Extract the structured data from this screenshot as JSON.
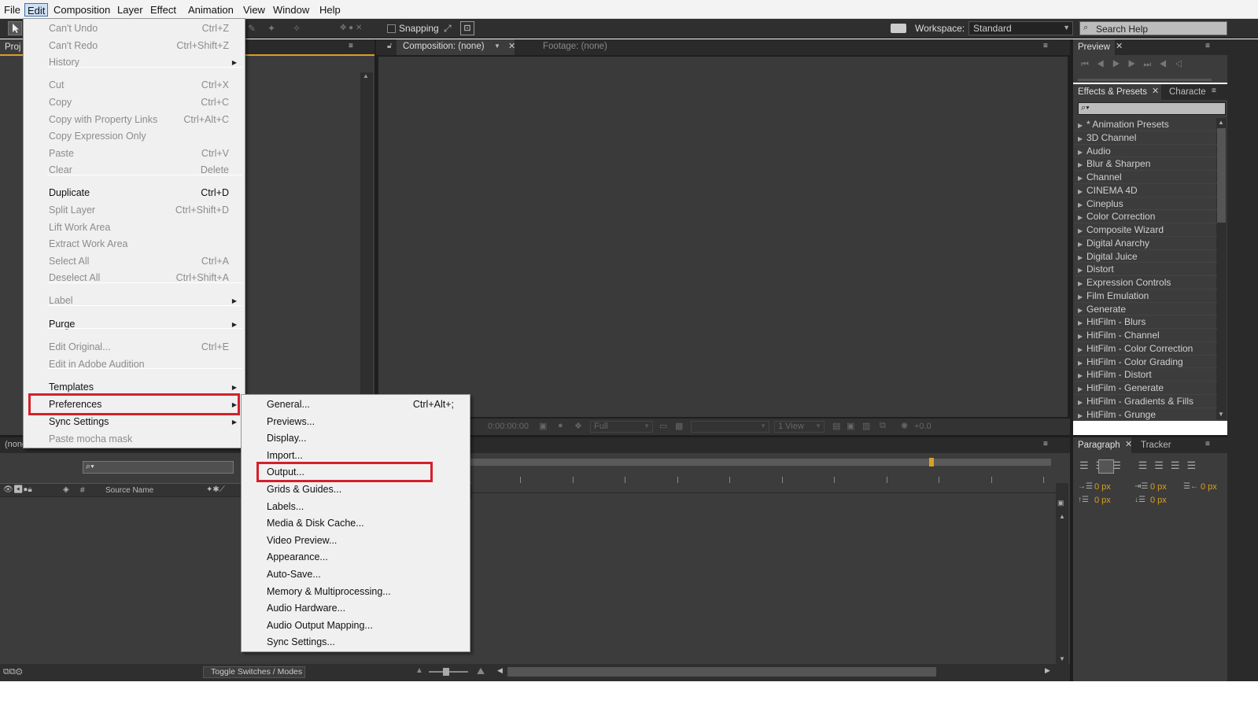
{
  "menubar": {
    "items": [
      "File",
      "Edit",
      "Composition",
      "Layer",
      "Effect",
      "Animation",
      "View",
      "Window",
      "Help"
    ],
    "active": "Edit"
  },
  "toolbar": {
    "snapping_label": "Snapping",
    "workspace_label": "Workspace:",
    "workspace_value": "Standard",
    "search_placeholder": "Search Help"
  },
  "project_panel": {
    "tab_label": "Proj",
    "composition_none": "(none)",
    "column_hash": "#",
    "column_source_name": "Source Name",
    "toggle_switches_label": "Toggle Switches / Modes"
  },
  "viewer": {
    "composition_tab": "Composition: (none)",
    "footage_tab": "Footage: (none)",
    "timecode": "0:00:00:00",
    "resolution": "Full",
    "views": "1 View",
    "exposure": "+0.0"
  },
  "preview_panel": {
    "tab_label": "Preview"
  },
  "effects_panel": {
    "tab_label": "Effects & Presets",
    "tab2_label": "Characte",
    "search_placeholder": "",
    "items": [
      "* Animation Presets",
      "3D Channel",
      "Audio",
      "Blur & Sharpen",
      "Channel",
      "CINEMA 4D",
      "Cineplus",
      "Color Correction",
      "Composite Wizard",
      "Digital Anarchy",
      "Digital Juice",
      "Distort",
      "Expression Controls",
      "Film Emulation",
      "Generate",
      "HitFilm - Blurs",
      "HitFilm - Channel",
      "HitFilm - Color Correction",
      "HitFilm - Color Grading",
      "HitFilm - Distort",
      "HitFilm - Generate",
      "HitFilm - Gradients & Fills",
      "HitFilm - Grunge"
    ]
  },
  "paragraph_panel": {
    "tab_label": "Paragraph",
    "tab2_label": "Tracker",
    "fields": [
      "0 px",
      "0 px",
      "0 px",
      "0 px",
      "0 px"
    ]
  },
  "edit_menu": {
    "items": [
      {
        "label": "Can't Undo",
        "shortcut": "Ctrl+Z",
        "disabled": true
      },
      {
        "label": "Can't Redo",
        "shortcut": "Ctrl+Shift+Z",
        "disabled": true
      },
      {
        "label": "History",
        "shortcut": "",
        "disabled": true,
        "submenu": true
      },
      {
        "label": "Cut",
        "shortcut": "Ctrl+X",
        "disabled": true
      },
      {
        "label": "Copy",
        "shortcut": "Ctrl+C",
        "disabled": true
      },
      {
        "label": "Copy with Property Links",
        "shortcut": "Ctrl+Alt+C",
        "disabled": true
      },
      {
        "label": "Copy Expression Only",
        "shortcut": "",
        "disabled": true
      },
      {
        "label": "Paste",
        "shortcut": "Ctrl+V",
        "disabled": true
      },
      {
        "label": "Clear",
        "shortcut": "Delete",
        "disabled": true
      },
      {
        "label": "Duplicate",
        "shortcut": "Ctrl+D",
        "disabled": false
      },
      {
        "label": "Split Layer",
        "shortcut": "Ctrl+Shift+D",
        "disabled": true
      },
      {
        "label": "Lift Work Area",
        "shortcut": "",
        "disabled": true
      },
      {
        "label": "Extract Work Area",
        "shortcut": "",
        "disabled": true
      },
      {
        "label": "Select All",
        "shortcut": "Ctrl+A",
        "disabled": true
      },
      {
        "label": "Deselect All",
        "shortcut": "Ctrl+Shift+A",
        "disabled": true
      },
      {
        "label": "Label",
        "shortcut": "",
        "disabled": true,
        "submenu": true
      },
      {
        "label": "Purge",
        "shortcut": "",
        "disabled": false,
        "submenu": true
      },
      {
        "label": "Edit Original...",
        "shortcut": "Ctrl+E",
        "disabled": true
      },
      {
        "label": "Edit in Adobe Audition",
        "shortcut": "",
        "disabled": true
      },
      {
        "label": "Templates",
        "shortcut": "",
        "disabled": false,
        "submenu": true
      },
      {
        "label": "Preferences",
        "shortcut": "",
        "disabled": false,
        "submenu": true,
        "highlighted": true
      },
      {
        "label": "Sync Settings",
        "shortcut": "",
        "disabled": false,
        "submenu": true
      },
      {
        "label": "Paste mocha mask",
        "shortcut": "",
        "disabled": true
      }
    ]
  },
  "preferences_menu": {
    "items": [
      {
        "label": "General...",
        "shortcut": "Ctrl+Alt+;"
      },
      {
        "label": "Previews...",
        "shortcut": ""
      },
      {
        "label": "Display...",
        "shortcut": ""
      },
      {
        "label": "Import...",
        "shortcut": ""
      },
      {
        "label": "Output...",
        "shortcut": "",
        "highlighted": true
      },
      {
        "label": "Grids & Guides...",
        "shortcut": ""
      },
      {
        "label": "Labels...",
        "shortcut": ""
      },
      {
        "label": "Media & Disk Cache...",
        "shortcut": ""
      },
      {
        "label": "Video Preview...",
        "shortcut": ""
      },
      {
        "label": "Appearance...",
        "shortcut": ""
      },
      {
        "label": "Auto-Save...",
        "shortcut": ""
      },
      {
        "label": "Memory & Multiprocessing...",
        "shortcut": ""
      },
      {
        "label": "Audio Hardware...",
        "shortcut": ""
      },
      {
        "label": "Audio Output Mapping...",
        "shortcut": ""
      },
      {
        "label": "Sync Settings...",
        "shortcut": ""
      }
    ]
  },
  "colors": {
    "highlight_box": "#d4202b",
    "panel_bg": "#3c3c3c",
    "menu_bg": "#f0f0f0",
    "accent_orange": "#d8a024"
  }
}
